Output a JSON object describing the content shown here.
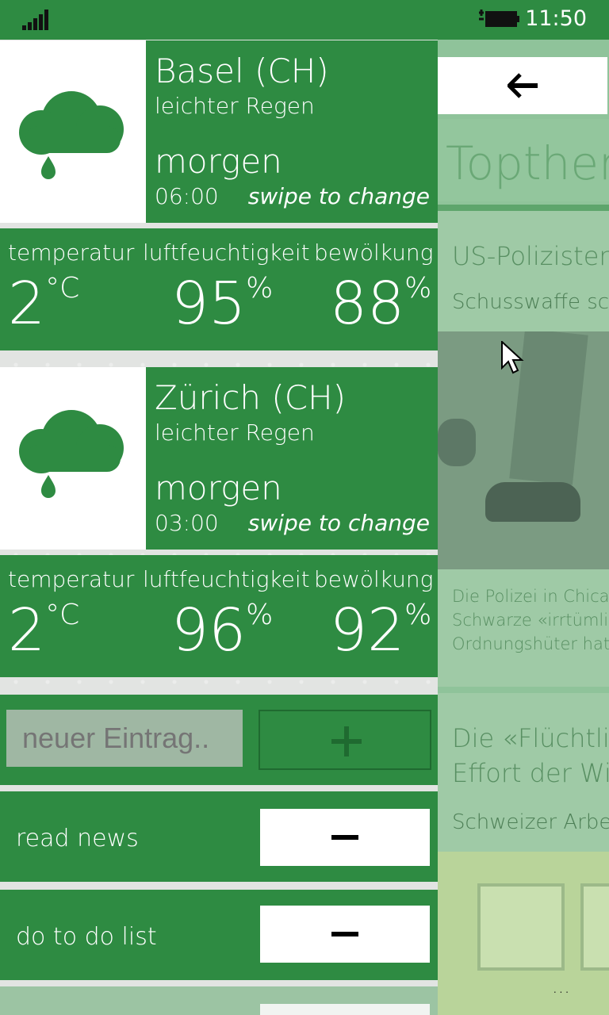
{
  "statusbar": {
    "time": "11:50"
  },
  "weather": [
    {
      "city": "Basel (CH)",
      "condition": "leichter Regen",
      "when": "morgen",
      "time": "06:00",
      "hint": "swipe to change",
      "labels": [
        "temperatur",
        "luftfeuchtigkeit",
        "bewölkung"
      ],
      "temp": "2",
      "temp_unit": "°C",
      "humidity": "95",
      "clouds": "88",
      "pct": "%"
    },
    {
      "city": "Zürich (CH)",
      "condition": "leichter Regen",
      "when": "morgen",
      "time": "03:00",
      "hint": "swipe to change",
      "labels": [
        "temperatur",
        "luftfeuchtigkeit",
        "bewölkung"
      ],
      "temp": "2",
      "temp_unit": "°C",
      "humidity": "96",
      "clouds": "92",
      "pct": "%"
    }
  ],
  "todo": {
    "placeholder": "neuer Eintrag..",
    "add_label": "+",
    "items": [
      "read news",
      "do to do list"
    ]
  },
  "news": {
    "heading": "Topthem",
    "article1_title": "US-Polizisten",
    "article1_sub": "Schusswaffe sch",
    "article1_body": [
      "Die Polizei in Chica",
      "Schwarze «irrtümlic",
      "Ordnungshüter hat"
    ],
    "article2_title": [
      "Die «Flüchtli",
      "Effort der Wi"
    ],
    "article2_sub": "Schweizer Arbeit",
    "more": "..."
  },
  "colors": {
    "accent": "#2e8b42",
    "panel": "#8fc39a"
  }
}
